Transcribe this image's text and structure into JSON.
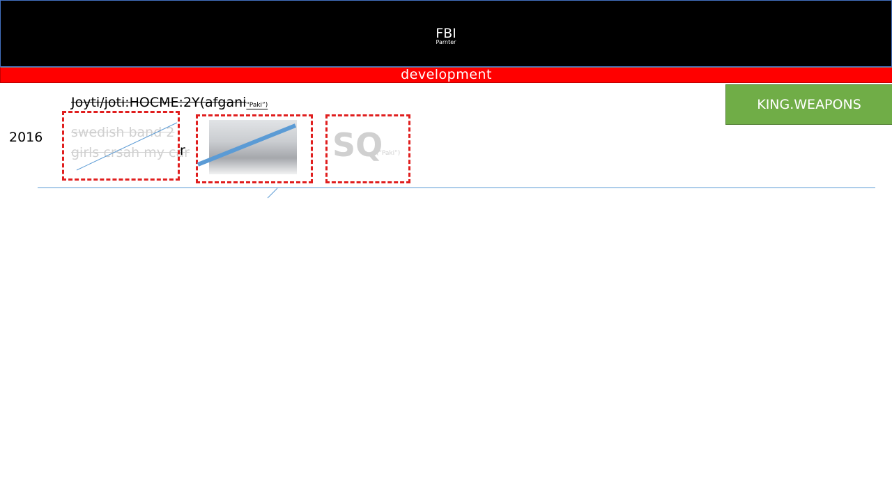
{
  "header": {
    "title": "FBI",
    "subtitle": "Parnter"
  },
  "banner": {
    "label": "development"
  },
  "action": {
    "label": "KING.WEAPONS"
  },
  "timeline": {
    "year": "2016",
    "headline": "Joyti/joti:HOCME:2Y(afgani",
    "headline_small": "“Paki”)",
    "card1_text": "swedish band 2 girls crsah my car",
    "card1_suffix": "r",
    "card3_big": "SQ",
    "card3_small": "(“Paki”)"
  },
  "colors": {
    "header_bg": "#000000",
    "banner_bg": "#ff0000",
    "action_bg": "#70ad47",
    "dashed_border": "#e01e1e",
    "line": "#5b9bd5"
  }
}
